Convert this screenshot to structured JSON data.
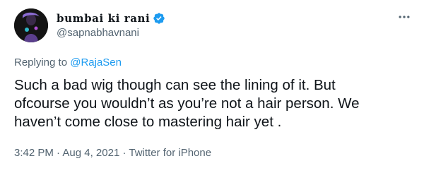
{
  "author": {
    "display_name": "bumbai ki rani",
    "handle": "@sapnabhavnani",
    "avatar_icon": "profile-avatar",
    "verified_icon": "verified-badge-icon",
    "verified_color": "#1d9bf0"
  },
  "menu": {
    "more_icon": "more-options-icon"
  },
  "reply": {
    "prefix": "Replying to",
    "target": "@RajaSen"
  },
  "tweet": {
    "lines": [
      "Such a bad wig though can see the lining of it. But",
      "ofcourse you wouldn’t as you’re not a hair person. We",
      "haven’t come close to mastering hair yet ."
    ]
  },
  "meta": {
    "time": "3:42 PM",
    "separator": " · ",
    "date": "Aug 4, 2021",
    "source": "Twitter for iPhone"
  },
  "colors": {
    "text": "#0f1419",
    "secondary": "#536471",
    "link": "#1d9bf0"
  }
}
